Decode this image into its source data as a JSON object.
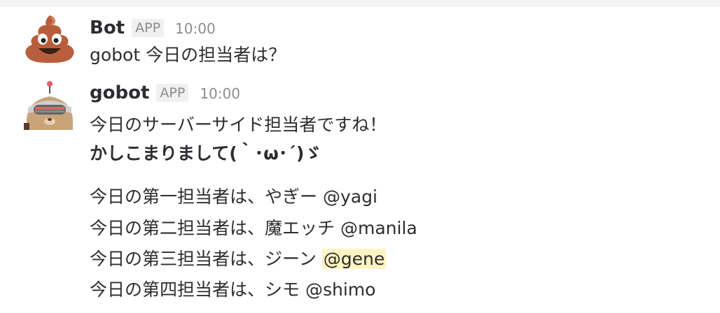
{
  "messages": [
    {
      "sender": "Bot",
      "badge": "APP",
      "time": "10:00",
      "text": "gobot 今日の担当者は？",
      "avatar_icon": "poop-emoji-icon"
    },
    {
      "sender": "gobot",
      "badge": "APP",
      "time": "10:00",
      "avatar_icon": "gopher-robot-icon",
      "line1": "今日のサーバーサイド担当者ですね！",
      "line2": "かしこまりまして(｀･ω･´)ゞ",
      "assignments": [
        {
          "prefix": "今日の第一担当者は、やぎー",
          "mention": "@yagi"
        },
        {
          "prefix": "今日の第二担当者は、魔エッチ",
          "mention": "@manila"
        },
        {
          "prefix": "今日の第三担当者は、ジーン",
          "mention": "@gene"
        },
        {
          "prefix": "今日の第四担当者は、シモ",
          "mention": "@shimo"
        }
      ]
    }
  ],
  "colors": {
    "mention_highlight": "#fff3c2",
    "badge_bg": "#f0f0f0",
    "meta_text": "#8c8c8c"
  }
}
